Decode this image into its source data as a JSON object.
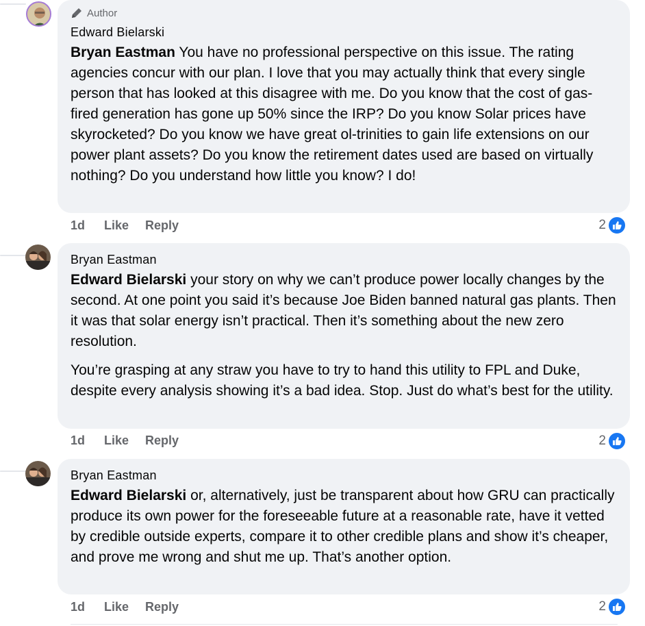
{
  "comments": [
    {
      "badge": "Author",
      "author": "Edward Bielarski",
      "mention": "Bryan Eastman",
      "text": " You have no professional perspective on this issue. The rating agencies concur with our plan. I love that you may actually think that every single person that has looked at this disagree with me. Do you know that the cost of gas-fired generation has gone up 50% since the IRP? Do you know Solar prices have skyrocketed? Do you know we have great ol-trinities to gain life extensions on our power plant assets? Do you know the retirement dates used are based on virtually nothing? Do you understand how little you know? I do!",
      "time": "1d",
      "like_label": "Like",
      "reply_label": "Reply",
      "reaction_count": "2"
    },
    {
      "author": "Bryan Eastman",
      "mention": "Edward Bielarski",
      "text": " your story on why we can’t produce power locally changes by the second. At one point you said it’s because Joe Biden banned natural gas plants. Then it was that solar energy isn’t practical. Then it’s something about the new zero resolution.",
      "text2": "You’re grasping at any straw you have to try to hand this utility to FPL and Duke, despite every analysis showing it’s a bad idea. Stop. Just do what’s best for the utility.",
      "time": "1d",
      "like_label": "Like",
      "reply_label": "Reply",
      "reaction_count": "2"
    },
    {
      "author": "Bryan Eastman",
      "mention": "Edward Bielarski",
      "text": " or, alternatively, just be transparent about how GRU can practically produce its own power for the foreseeable future at a reasonable rate, have it vetted by credible outside experts, compare it to other credible plans and show it’s cheaper, and prove me wrong and shut me up. That’s another option.",
      "time": "1d",
      "like_label": "Like",
      "reply_label": "Reply",
      "reaction_count": "2"
    }
  ],
  "icons": {
    "badge": "pencil-icon",
    "reaction": "thumbs-up-icon"
  },
  "colors": {
    "bubble": "#f0f2f5",
    "meta_text": "#65676b",
    "like_blue": "#1877f2"
  }
}
